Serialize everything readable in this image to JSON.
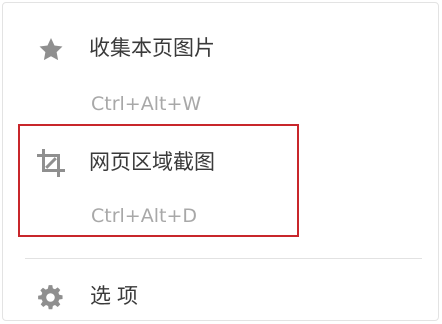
{
  "menu": {
    "items": [
      {
        "icon": "star-icon",
        "label": "收集本页图片",
        "shortcut": "Ctrl+Alt+W"
      },
      {
        "icon": "crop-icon",
        "label": "网页区域截图",
        "shortcut": "Ctrl+Alt+D",
        "highlighted": true
      },
      {
        "icon": "gear-icon",
        "label": "选项"
      }
    ]
  },
  "colors": {
    "icon": "#8f8f8f",
    "label": "#3a3a3a",
    "shortcut": "#a8a8a8",
    "highlight_border": "#c8262b",
    "divider": "#e2e2e2"
  }
}
